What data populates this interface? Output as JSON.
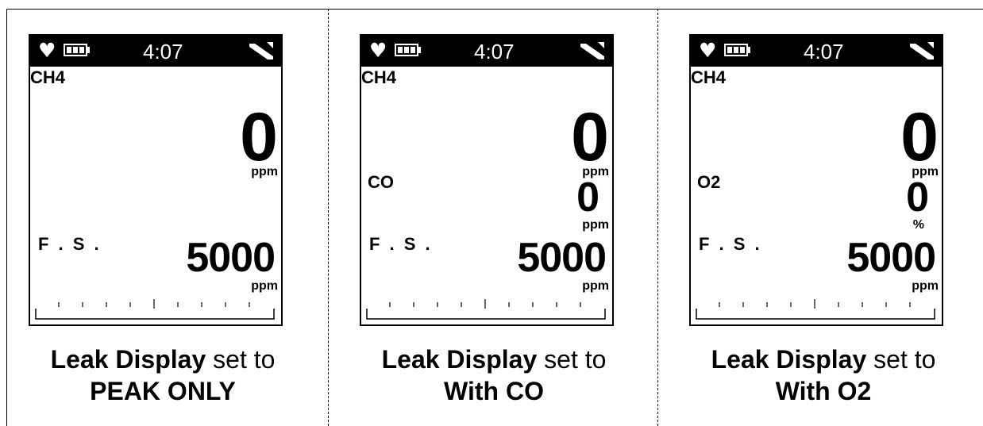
{
  "panels": [
    {
      "status": {
        "time": "4:07",
        "heart": "heart-icon",
        "battery": "battery-icon",
        "pump": "pump-icon"
      },
      "gas1": {
        "name": "CH4",
        "value": "0",
        "unit": "ppm"
      },
      "gas2": null,
      "fullscale": {
        "label": "F . S .",
        "value": "5000",
        "unit": "ppm"
      },
      "caption": {
        "line1_bold": "Leak Display",
        "line1_rest": " set to",
        "line2_bold": "PEAK ONLY"
      }
    },
    {
      "status": {
        "time": "4:07",
        "heart": "heart-icon",
        "battery": "battery-icon",
        "pump": "pump-icon"
      },
      "gas1": {
        "name": "CH4",
        "value": "0",
        "unit": "ppm"
      },
      "gas2": {
        "name": "CO",
        "value": "0",
        "unit": "ppm"
      },
      "fullscale": {
        "label": "F . S .",
        "value": "5000",
        "unit": "ppm"
      },
      "caption": {
        "line1_bold": "Leak Display",
        "line1_rest": " set to",
        "line2_bold": "With CO"
      }
    },
    {
      "status": {
        "time": "4:07",
        "heart": "heart-icon",
        "battery": "battery-icon",
        "pump": "pump-icon"
      },
      "gas1": {
        "name": "CH4",
        "value": "0",
        "unit": "ppm"
      },
      "gas2": {
        "name": "O2",
        "value": "0",
        "unit": "%"
      },
      "fullscale": {
        "label": "F . S .",
        "value": "5000",
        "unit": "ppm"
      },
      "caption": {
        "line1_bold": "Leak Display",
        "line1_rest": " set to",
        "line2_bold": "With O2"
      }
    }
  ],
  "colors": {
    "screen_fg": "#000000",
    "statusbar_bg": "#000000",
    "statusbar_fg": "#ffffff",
    "background": "#ffffff"
  }
}
